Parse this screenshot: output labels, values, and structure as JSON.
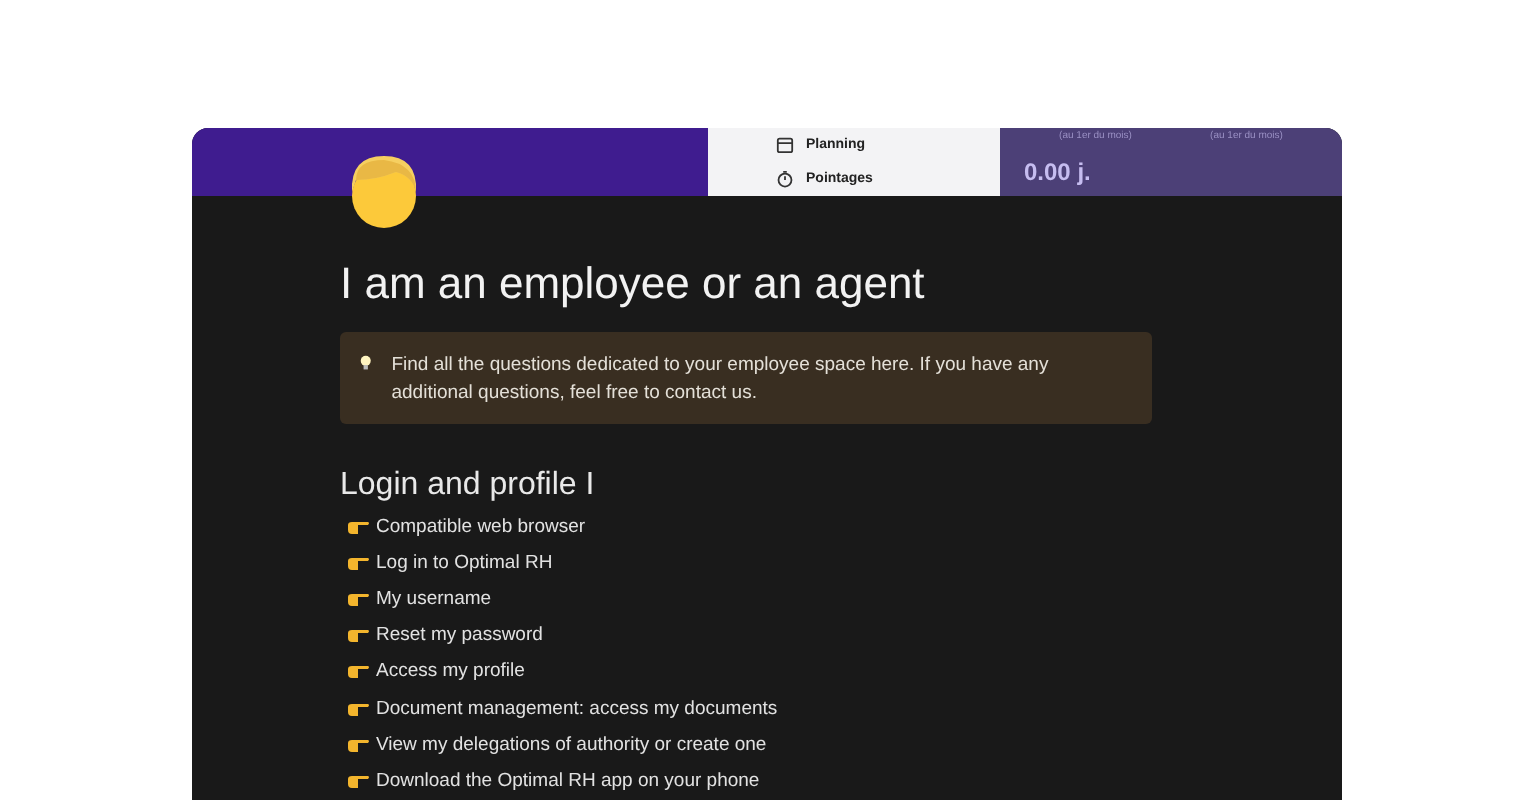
{
  "cover": {
    "menu": [
      {
        "label": "Planning",
        "kind": "calendar"
      },
      {
        "label": "Pointages",
        "kind": "stopwatch"
      }
    ],
    "stats": {
      "captions": [
        "(au 1er du mois)",
        "(au 1er du mois)"
      ],
      "value": "0.00 j."
    }
  },
  "title": "I am an employee or an agent",
  "callout": "Find all the questions dedicated to your employee space here. If you have any additional questions, feel free to contact us.",
  "section": {
    "heading": "Login and profile I",
    "links": [
      "Compatible web browser",
      "Log in to Optimal RH",
      "My username",
      "Reset my password",
      "Access my profile",
      "Document management: access my documents",
      "View my delegations of authority or create one",
      "Download the Optimal RH app on your phone"
    ]
  }
}
